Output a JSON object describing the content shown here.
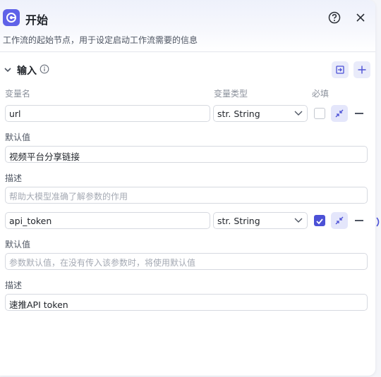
{
  "header": {
    "title": "开始",
    "subtitle": "工作流的起始节点，用于设定启动工作流需要的信息"
  },
  "section": {
    "title": "输入"
  },
  "columns": {
    "name": "变量名",
    "type": "变量类型",
    "required": "必填"
  },
  "variables": [
    {
      "name": "url",
      "type": "str. String",
      "required": false,
      "default_label": "默认值",
      "default_value": "视频平台分享链接",
      "default_placeholder": "",
      "desc_label": "描述",
      "desc_value": "",
      "desc_placeholder": "帮助大模型准确了解参数的作用"
    },
    {
      "name": "api_token",
      "type": "str. String",
      "required": true,
      "default_label": "默认值",
      "default_value": "",
      "default_placeholder": "参数默认值，在没有传入该参数时，将使用默认值",
      "desc_label": "描述",
      "desc_value": "速推API token",
      "desc_placeholder": ""
    }
  ],
  "colors": {
    "accent": "#4c51d6",
    "accent_light": "#e4e6fb",
    "node_icon": "#5f62e8"
  }
}
